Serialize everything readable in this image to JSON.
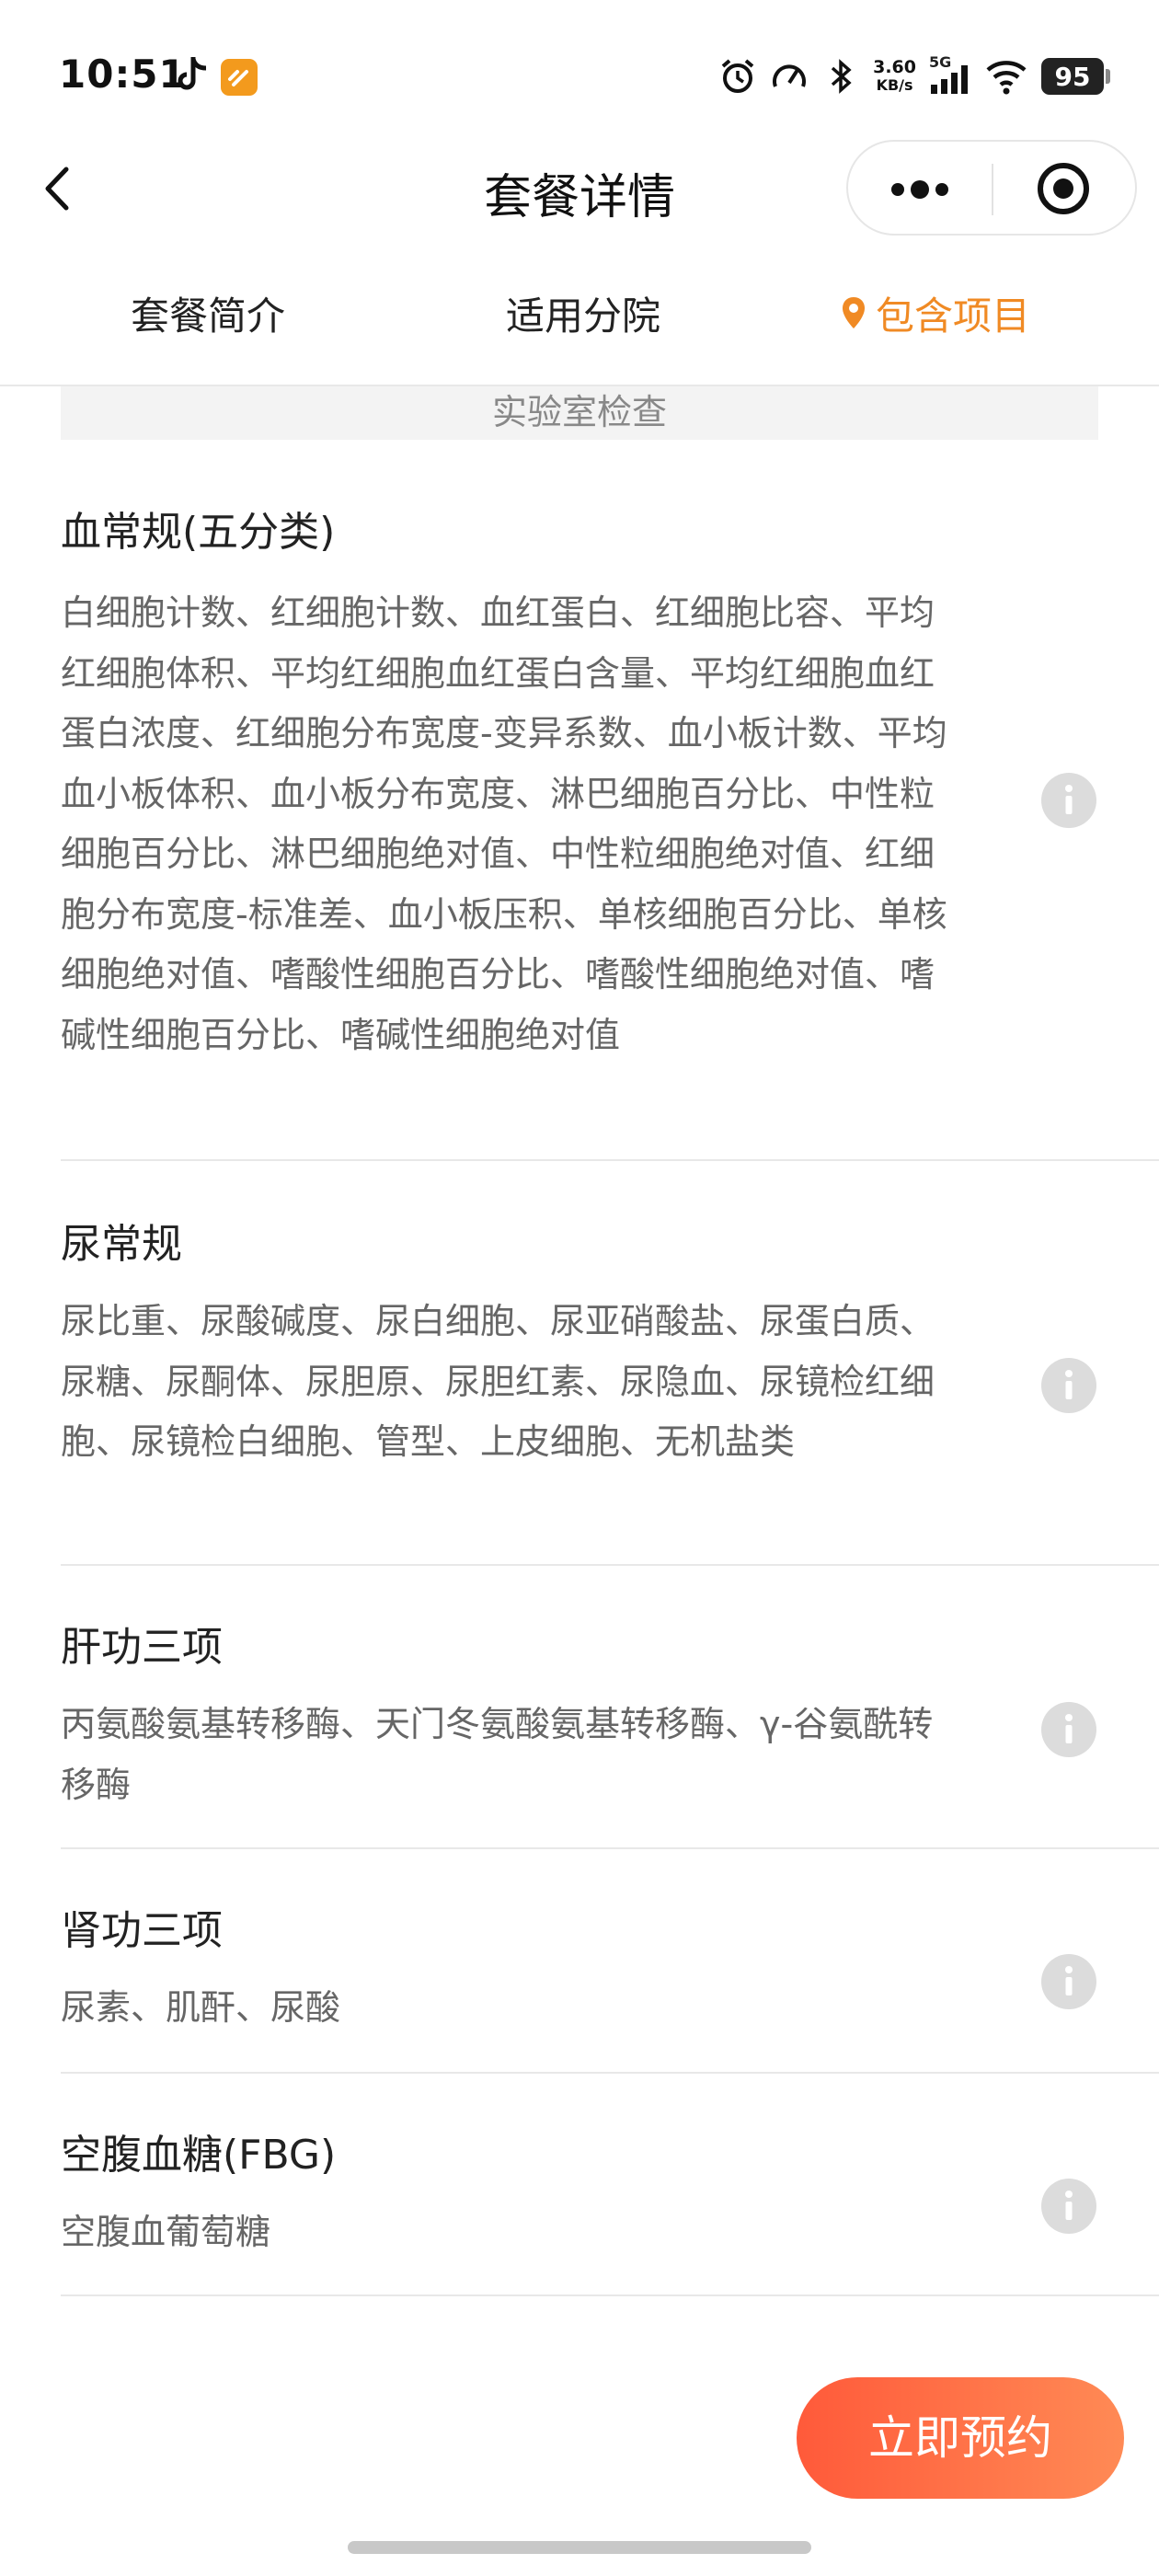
{
  "status_bar": {
    "time": "10:51",
    "net_speed_value": "3.60",
    "net_speed_unit": "KB/s",
    "network_type": "5G",
    "battery": "95",
    "icons": [
      "tiktok-icon",
      "app-badge-icon",
      "alarm-icon",
      "speedometer-icon",
      "bluetooth-icon",
      "signal-icon",
      "wifi-icon",
      "battery-icon"
    ]
  },
  "nav": {
    "title": "套餐详情",
    "icons": [
      "back-chevron-icon",
      "more-dots-icon",
      "target-circle-icon"
    ]
  },
  "tabs": [
    {
      "label": "套餐简介",
      "active": false
    },
    {
      "label": "适用分院",
      "active": false
    },
    {
      "label": "包含项目",
      "active": true,
      "icon": "location-pin-icon"
    }
  ],
  "section": {
    "title": "实验室检查"
  },
  "items": [
    {
      "name": "血常规(五分类)",
      "description": "白细胞计数、红细胞计数、血红蛋白、红细胞比容、平均红细胞体积、平均红细胞血红蛋白含量、平均红细胞血红蛋白浓度、红细胞分布宽度-变异系数、血小板计数、平均血小板体积、血小板分布宽度、淋巴细胞百分比、中性粒细胞百分比、淋巴细胞绝对值、中性粒细胞绝对值、红细胞分布宽度-标准差、血小板压积、单核细胞百分比、单核细胞绝对值、嗜酸性细胞百分比、嗜酸性细胞绝对值、嗜碱性细胞百分比、嗜碱性细胞绝对值"
    },
    {
      "name": "尿常规",
      "description": "尿比重、尿酸碱度、尿白细胞、尿亚硝酸盐、尿蛋白质、尿糖、尿酮体、尿胆原、尿胆红素、尿隐血、尿镜检红细胞、尿镜检白细胞、管型、上皮细胞、无机盐类"
    },
    {
      "name": "肝功三项",
      "description": "丙氨酸氨基转移酶、天门冬氨酸氨基转移酶、γ-谷氨酰转移酶"
    },
    {
      "name": "肾功三项",
      "description": "尿素、肌酐、尿酸"
    },
    {
      "name": "空腹血糖(FBG)",
      "description": "空腹血葡萄糖"
    }
  ],
  "actions": {
    "book_label": "立即预约"
  },
  "colors": {
    "accent": "#f08a24",
    "button_start": "#ff5a3a",
    "button_end": "#ff8a55"
  }
}
